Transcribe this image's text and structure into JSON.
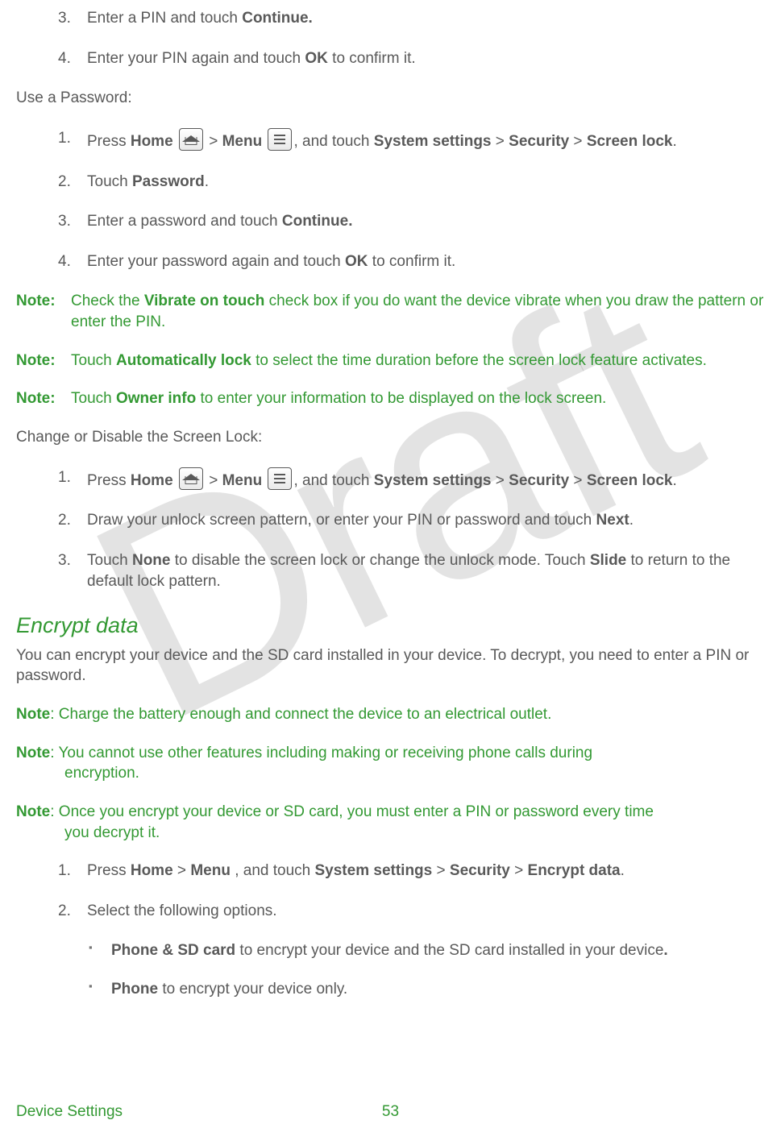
{
  "watermark": "Draft",
  "pin_steps": {
    "s3": {
      "num": "3.",
      "a": "Enter a PIN and touch ",
      "b": "Continue."
    },
    "s4": {
      "num": "4.",
      "a": "Enter your PIN again and touch ",
      "b": "OK",
      "c": " to confirm it."
    }
  },
  "pw_heading": "Use a Password:",
  "pw_steps": {
    "s1": {
      "num": "1.",
      "a": "Press ",
      "home": "Home",
      "gt1": " > ",
      "menu": "Menu",
      "b": ", and touch ",
      "ss": "System settings",
      "gt2": " > ",
      "sec": "Security",
      "gt3": " > ",
      "sl": "Screen lock",
      "dot": "."
    },
    "s2": {
      "num": "2.",
      "a": "Touch ",
      "b": "Password",
      "c": "."
    },
    "s3": {
      "num": "3.",
      "a": "Enter a password and touch ",
      "b": "Continue."
    },
    "s4": {
      "num": "4.",
      "a": "Enter your password again and touch ",
      "b": "OK",
      "c": " to confirm it."
    }
  },
  "notes_block1": {
    "n1": {
      "label": "Note:",
      "a": "Check the ",
      "b": "Vibrate on touch",
      "c": " check box if you do want the device vibrate when you draw the pattern or enter the PIN."
    },
    "n2": {
      "label": "Note:",
      "a": "Touch ",
      "b": "Automatically lock",
      "c": " to select the time duration before the screen lock feature activates."
    },
    "n3": {
      "label": "Note:",
      "a": "Touch ",
      "b": "Owner info",
      "c": " to enter your information to be displayed on the lock screen."
    }
  },
  "change_heading": "Change or Disable the Screen Lock:",
  "change_steps": {
    "s1": {
      "num": "1.",
      "a": "Press ",
      "home": "Home",
      "gt1": " > ",
      "menu": "Menu",
      "b": ", and touch ",
      "ss": "System settings",
      "gt2": " > ",
      "sec": "Security",
      "gt3": " > ",
      "sl": "Screen lock",
      "dot": "."
    },
    "s2": {
      "num": "2.",
      "a": "Draw your unlock screen pattern, or enter your PIN or password and touch ",
      "b": "Next",
      "c": "."
    },
    "s3": {
      "num": "3.",
      "a": "Touch ",
      "b": "None",
      "c": " to disable the screen lock or change the unlock mode. Touch ",
      "d": "Slide",
      "e": " to return to the default lock pattern."
    }
  },
  "encrypt": {
    "heading": "Encrypt data",
    "intro": "You can encrypt your device and the SD card installed in your device. To decrypt, you need to enter a PIN or password."
  },
  "notes_block2": {
    "n1": {
      "label": "Note",
      "a": ": Charge the battery enough and connect the device to an electrical outlet."
    },
    "n2": {
      "label": "Note",
      "a": ": You cannot use other features including making or receiving phone calls during ",
      "cont": "encryption."
    },
    "n3": {
      "label": "Note",
      "a": ": Once you encrypt your device or SD card, you must enter a PIN or password every time ",
      "cont": "you decrypt it."
    }
  },
  "encrypt_steps": {
    "s1": {
      "num": "1.",
      "a": "Press ",
      "home": "Home",
      "gt1": " > ",
      "menu": "Menu",
      "b": " , and touch ",
      "ss": "System settings",
      "gt2": " > ",
      "sec": "Security",
      "gt3": " > ",
      "ed": "Encrypt data",
      "dot": "."
    },
    "s2": {
      "num": "2.",
      "a": "Select the following options."
    }
  },
  "encrypt_bullets": {
    "b1": {
      "bold": "Phone & SD card",
      "a": " to encrypt your device and the SD card installed in your device",
      "dot": "."
    },
    "b2": {
      "bold": "Phone",
      "a": " to encrypt your device only."
    }
  },
  "footer": {
    "title": "Device Settings",
    "page": "53"
  }
}
